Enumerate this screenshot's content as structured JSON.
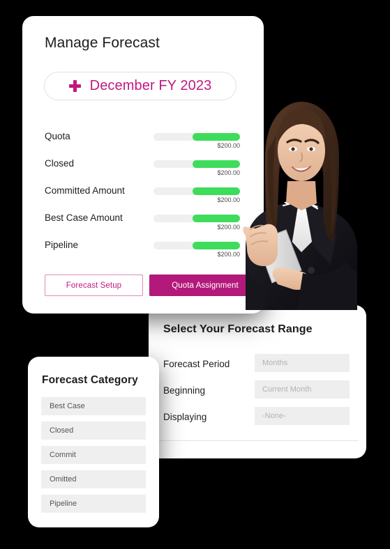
{
  "main_card": {
    "title": "Manage Forecast",
    "period_button": {
      "icon": "plus-icon",
      "label": "December FY 2023"
    },
    "metrics": [
      {
        "label": "Quota",
        "value": "$200.00",
        "fill_percent": 55
      },
      {
        "label": "Closed",
        "value": "$200.00",
        "fill_percent": 55
      },
      {
        "label": "Committed Amount",
        "value": "$200.00",
        "fill_percent": 55
      },
      {
        "label": "Best Case Amount",
        "value": "$200.00",
        "fill_percent": 55
      },
      {
        "label": "Pipeline",
        "value": "$200.00",
        "fill_percent": 55
      }
    ],
    "buttons": {
      "forecast_setup": "Forecast Setup",
      "quota_assignment": "Quota Assignment"
    }
  },
  "forecast_range_card": {
    "title": "Select Your Forecast Range",
    "rows": [
      {
        "label": "Forecast Period",
        "placeholder": "Months"
      },
      {
        "label": "Beginning",
        "placeholder": "Current Month"
      },
      {
        "label": "Displaying",
        "placeholder": "-None-"
      }
    ]
  },
  "forecast_category_card": {
    "title": "Forecast Category",
    "items": [
      "Best Case",
      "Closed",
      "Commit",
      "Omitted",
      "Pipeline"
    ]
  },
  "photo": {
    "alt": "businesswoman-holding-tablet"
  },
  "colors": {
    "accent_pink": "#c2187f",
    "accent_pink_solid": "#b3197a",
    "progress_green": "#3ddc5a",
    "track_gray": "#efefef",
    "field_gray": "#eeeeee",
    "background": "#000000",
    "card": "#ffffff"
  }
}
